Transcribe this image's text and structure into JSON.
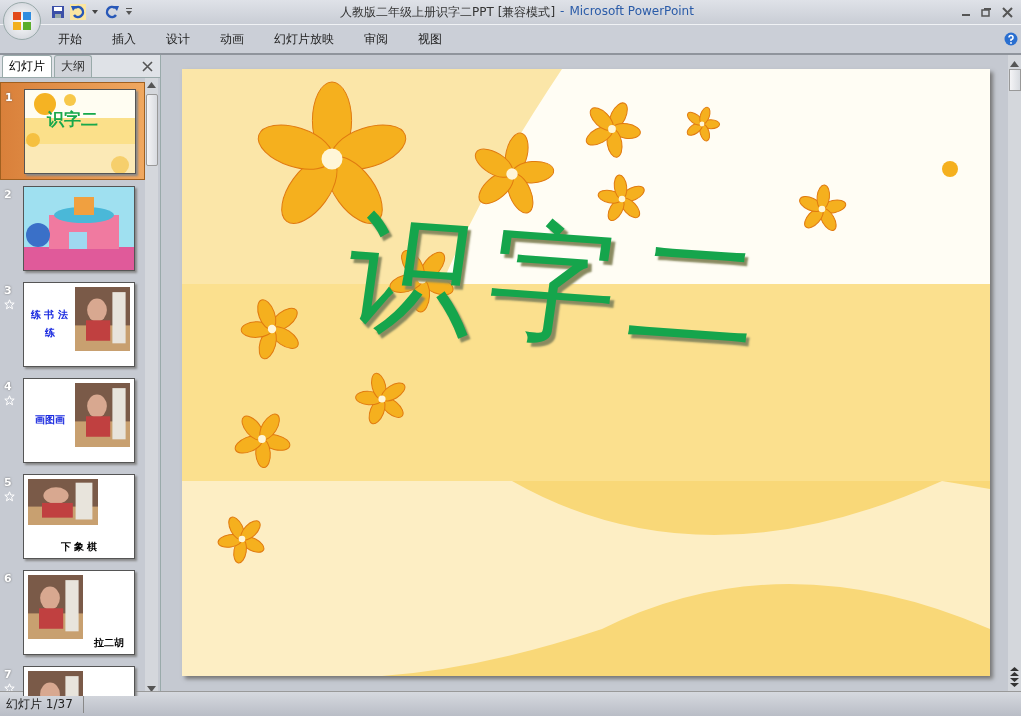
{
  "window": {
    "document": "人教版二年级上册识字二PPT [兼容模式]",
    "separator": "-",
    "app_name": "Microsoft PowerPoint"
  },
  "ribbon_tabs": [
    "开始",
    "插入",
    "设计",
    "动画",
    "幻灯片放映",
    "审阅",
    "视图"
  ],
  "panel_tabs": [
    {
      "label": "幻灯片",
      "selected": true
    },
    {
      "label": "大纲",
      "selected": false
    }
  ],
  "slides": [
    {
      "number": "1",
      "selected": true,
      "animated": false,
      "kind": "title",
      "texts": [
        "识字二"
      ]
    },
    {
      "number": "2",
      "selected": false,
      "animated": false,
      "kind": "cartoon"
    },
    {
      "number": "3",
      "selected": false,
      "animated": true,
      "kind": "photo-right",
      "texts": [
        "练 书 法",
        "练"
      ]
    },
    {
      "number": "4",
      "selected": false,
      "animated": true,
      "kind": "photo-right",
      "texts": [
        "画图画"
      ]
    },
    {
      "number": "5",
      "selected": false,
      "animated": true,
      "kind": "photo-top",
      "texts": [
        "下 象 棋"
      ]
    },
    {
      "number": "6",
      "selected": false,
      "animated": false,
      "kind": "photo-left",
      "texts": [
        "拉二胡"
      ]
    },
    {
      "number": "7",
      "selected": false,
      "animated": true,
      "kind": "photo-left"
    }
  ],
  "slide": {
    "title": "识字二"
  },
  "status_bar": {
    "slide_info": "幻灯片 1/37"
  }
}
